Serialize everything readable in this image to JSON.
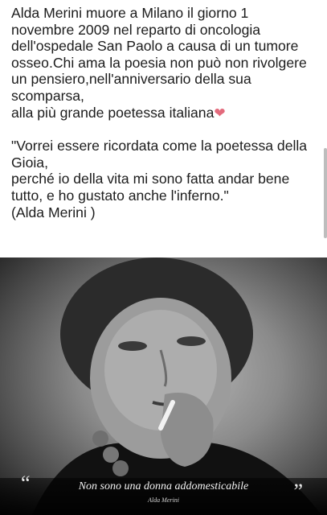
{
  "post": {
    "lines": [
      "Alda Merini muore a Milano il giorno 1",
      "novembre 2009 nel reparto di oncologia",
      "dell'ospedale San Paolo a causa di un tumore",
      "osseo.Chi ama la poesia non può non rivolgere",
      "un pensiero,nell'anniversario della sua",
      "scomparsa,",
      "alla più grande poetessa italiana"
    ],
    "heart": "❤",
    "quote_lines": [
      "\"Vorrei essere ricordata come la poetessa della",
      "Gioia,",
      "perché io della vita mi sono fatta andar bene",
      "tutto, e ho gustato anche l'inferno.\"",
      "(Alda Merini )"
    ]
  },
  "photo": {
    "caption": "Non sono una donna addomesticabile",
    "author": "Alda Merini",
    "quote_open": "“",
    "quote_close": "”"
  },
  "colors": {
    "text": "#1c1c1c",
    "heart": "#e36a7c"
  }
}
